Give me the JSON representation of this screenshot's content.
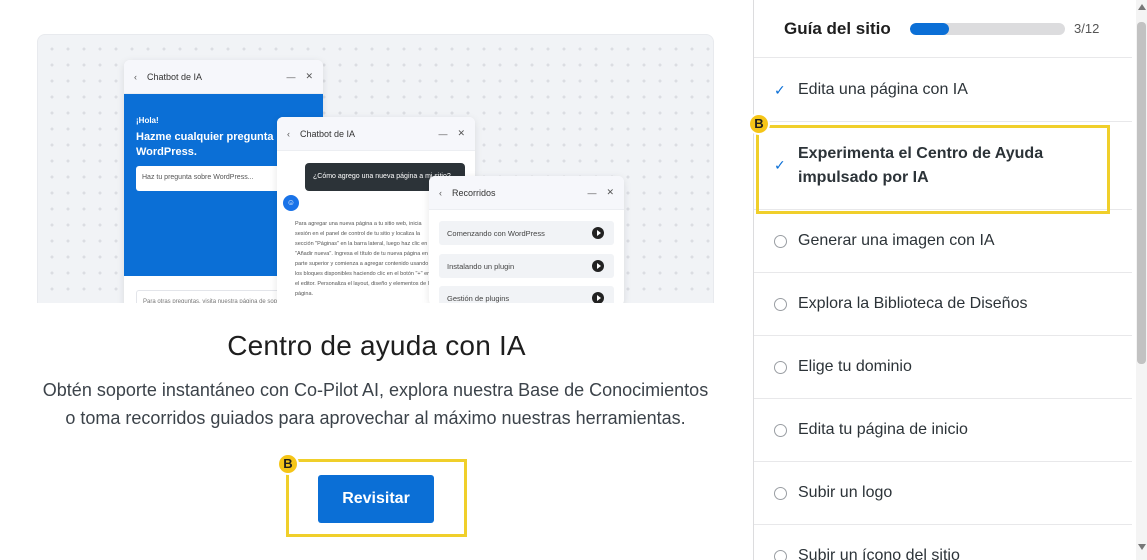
{
  "illustration": {
    "chat1": {
      "title": "Chatbot de IA",
      "greeting": "¡Hola!",
      "heading": "Hazme cualquier pregunta sobre WordPress.",
      "input_placeholder": "Haz tu pregunta sobre WordPress...",
      "footer_text": "Para otras preguntas, visita nuestra página de soporte"
    },
    "chat2": {
      "title": "Chatbot de IA",
      "question": "¿Cómo agrego una nueva página a mi sitio?",
      "answer": "Para agregar una nueva página a tu sitio web, inicia sesión en el panel de control de tu sitio y localiza la sección \"Páginas\" en la barra lateral, luego haz clic en \"Añadir nueva\". Ingresa el título de tu nueva página en la parte superior y comienza a agregar contenido usando los bloques disponibles haciendo clic en el botón \"+\" en el editor. Personaliza el layout, diseño y elementos de la página."
    },
    "tours": {
      "title": "Recorridos",
      "items": [
        "Comenzando con WordPress",
        "Instalando un plugin",
        "Gestión de plugins"
      ]
    }
  },
  "main": {
    "title": "Centro de ayuda con IA",
    "description": "Obtén soporte instantáneo con Co-Pilot AI, explora nuestra Base de Conocimientos o toma recorridos guiados para aprovechar al máximo nuestras herramientas.",
    "button_label": "Revisitar",
    "badge_label": "B"
  },
  "sidebar": {
    "title": "Guía del sitio",
    "progress_text": "3/12",
    "progress_fraction": 0.25,
    "badge_label": "B",
    "items": [
      {
        "label": "Edita una página con IA",
        "done": true
      },
      {
        "label": "Experimenta el Centro de Ayuda impulsado por IA",
        "done": true
      },
      {
        "label": "Generar una imagen con IA",
        "done": false
      },
      {
        "label": "Explora la Biblioteca de Diseños",
        "done": false
      },
      {
        "label": "Elige tu dominio",
        "done": false
      },
      {
        "label": "Edita tu página de inicio",
        "done": false
      },
      {
        "label": "Subir un logo",
        "done": false
      },
      {
        "label": "Subir un ícono del sitio",
        "done": false
      }
    ]
  },
  "colors": {
    "accent": "#0b6fd6",
    "highlight": "#f0cf2a",
    "badge": "#f5c518"
  }
}
